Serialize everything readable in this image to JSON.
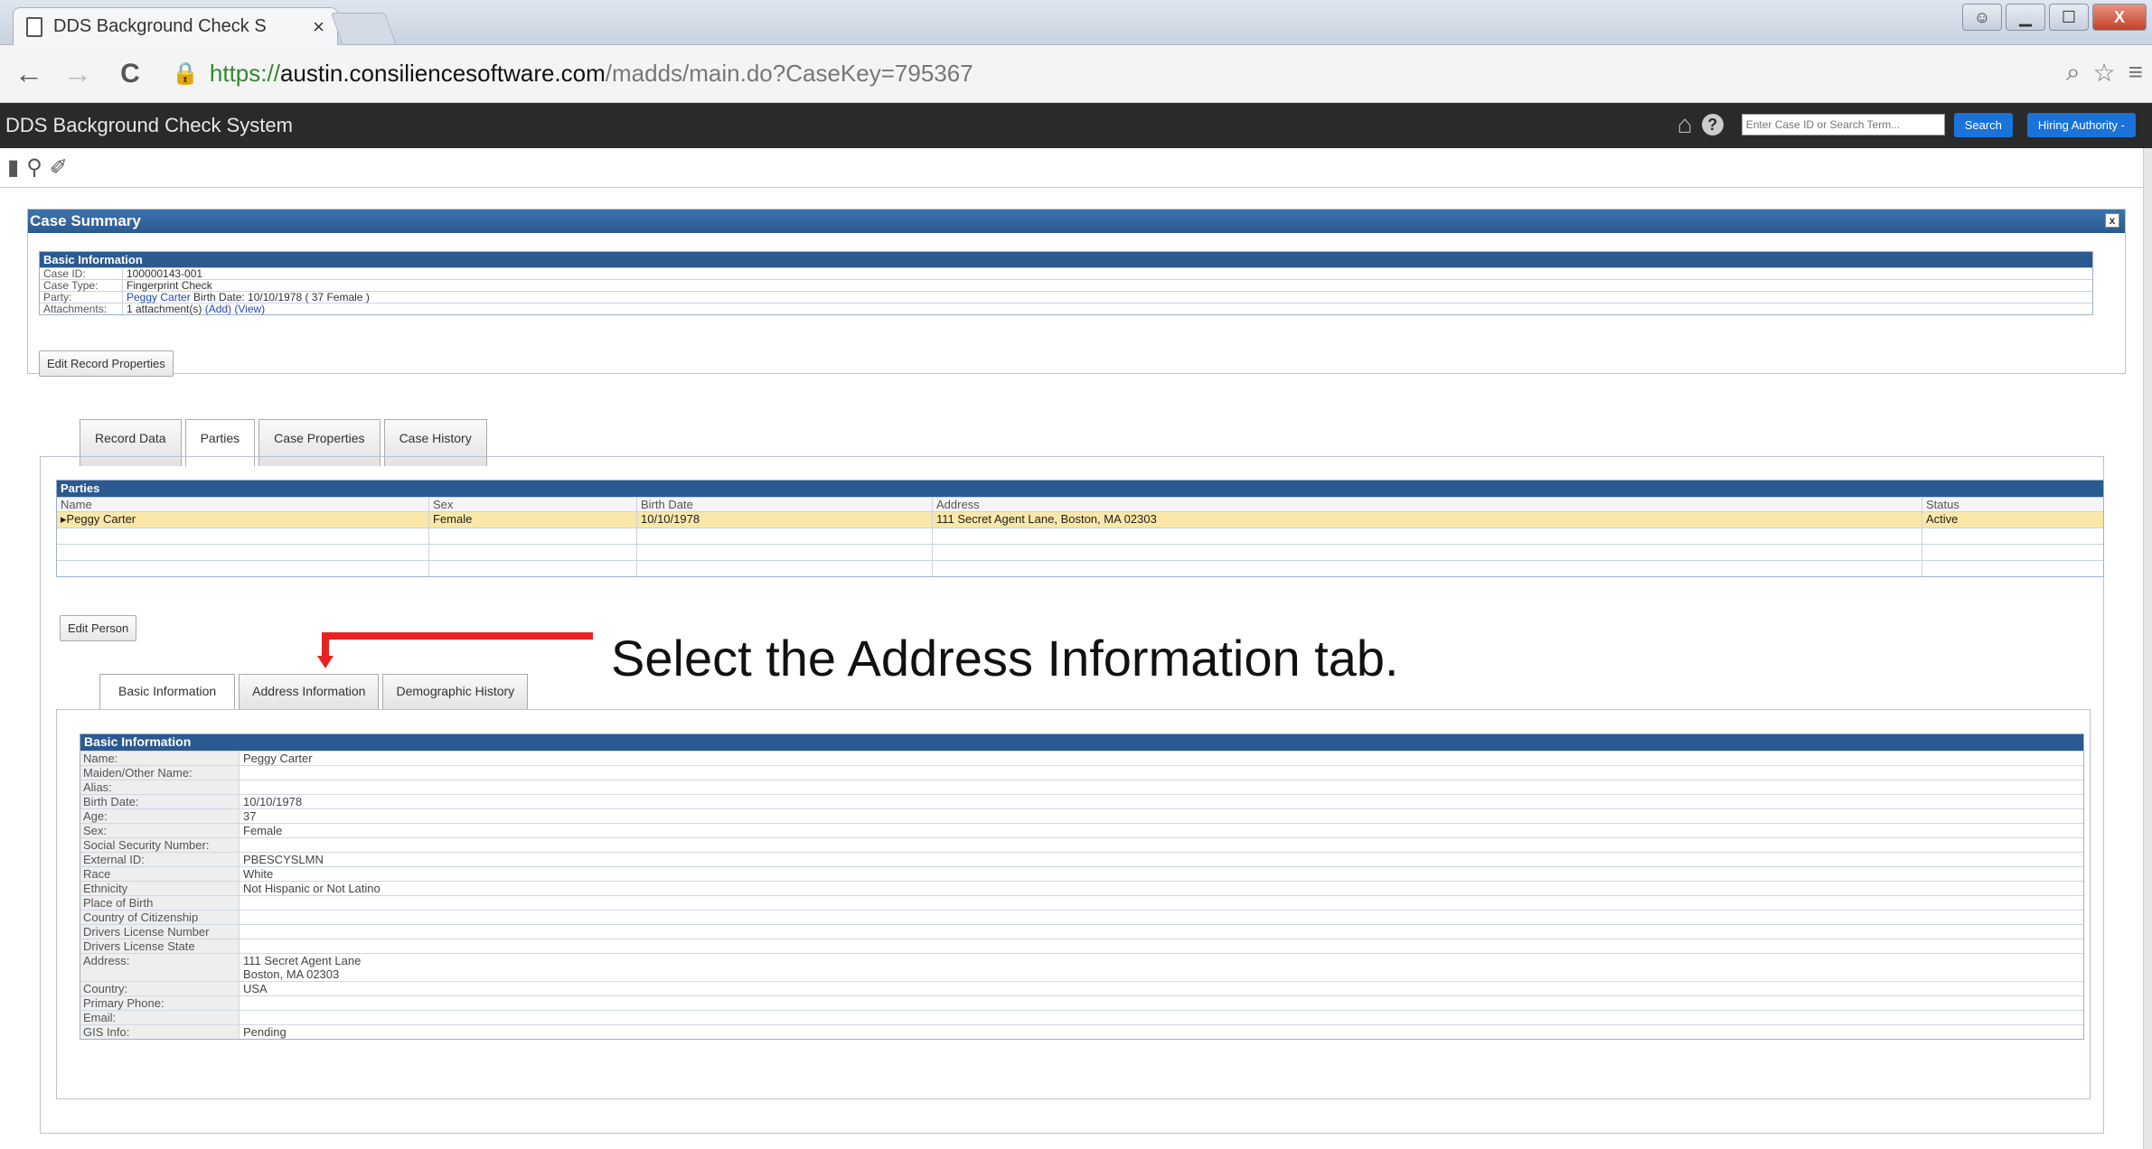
{
  "browser": {
    "tab_title": "DDS Background Check S",
    "url_scheme": "https://",
    "url_host": "austin.consiliencesoftware.com",
    "url_path": "/madds/main.do?CaseKey=795367"
  },
  "app": {
    "title": "DDS Background Check System",
    "search_placeholder": "Enter Case ID or Search Term...",
    "search_button": "Search",
    "role_button": "Hiring Authority -"
  },
  "case_summary": {
    "title": "Case Summary",
    "close_label": "x",
    "section_title": "Basic Information",
    "rows": [
      {
        "label": "Case ID:",
        "value": "100000143-001"
      },
      {
        "label": "Case Type:",
        "value": "Fingerprint Check"
      }
    ],
    "party_label": "Party:",
    "party_link": "Peggy Carter",
    "party_extra": " Birth Date: 10/10/1978 ( 37 Female )",
    "attachments_label": "Attachments:",
    "attachments_text": "1 attachment(s) ",
    "add_link": "(Add)",
    "view_link": "(View)",
    "edit_button": "Edit Record Properties"
  },
  "main_tabs": [
    "Record Data",
    "Parties",
    "Case Properties",
    "Case History"
  ],
  "parties": {
    "title": "Parties",
    "columns": [
      "Name",
      "Sex",
      "Birth Date",
      "Address",
      "Status"
    ],
    "rows": [
      {
        "name": "Peggy Carter",
        "sex": "Female",
        "birth": "10/10/1978",
        "address": "111 Secret Agent Lane, Boston, MA 02303",
        "status": "Active"
      }
    ],
    "edit_button": "Edit Person"
  },
  "annotation": "Select the Address Information tab.",
  "person_tabs": [
    "Basic Information",
    "Address Information",
    "Demographic History"
  ],
  "basic_info": {
    "title": "Basic Information",
    "rows": [
      {
        "label": "Name:",
        "value": "Peggy Carter"
      },
      {
        "label": "Maiden/Other Name:",
        "value": ""
      },
      {
        "label": "Alias:",
        "value": ""
      },
      {
        "label": "Birth Date:",
        "value": "10/10/1978"
      },
      {
        "label": "Age:",
        "value": "37"
      },
      {
        "label": "Sex:",
        "value": "Female"
      },
      {
        "label": "Social Security Number:",
        "value": ""
      },
      {
        "label": "External ID:",
        "value": "PBESCYSLMN"
      },
      {
        "label": "Race",
        "value": "White"
      },
      {
        "label": "Ethnicity",
        "value": "Not Hispanic or Not Latino"
      },
      {
        "label": "Place of Birth",
        "value": ""
      },
      {
        "label": "Country of Citizenship",
        "value": ""
      },
      {
        "label": "Drivers License Number",
        "value": ""
      },
      {
        "label": "Drivers License State",
        "value": ""
      },
      {
        "label": "Address:",
        "value": "111 Secret Agent Lane\nBoston, MA 02303"
      },
      {
        "label": "Country:",
        "value": "USA"
      },
      {
        "label": "Primary Phone:",
        "value": ""
      },
      {
        "label": "Email:",
        "value": ""
      },
      {
        "label": "GIS Info:",
        "value": "Pending"
      }
    ]
  }
}
